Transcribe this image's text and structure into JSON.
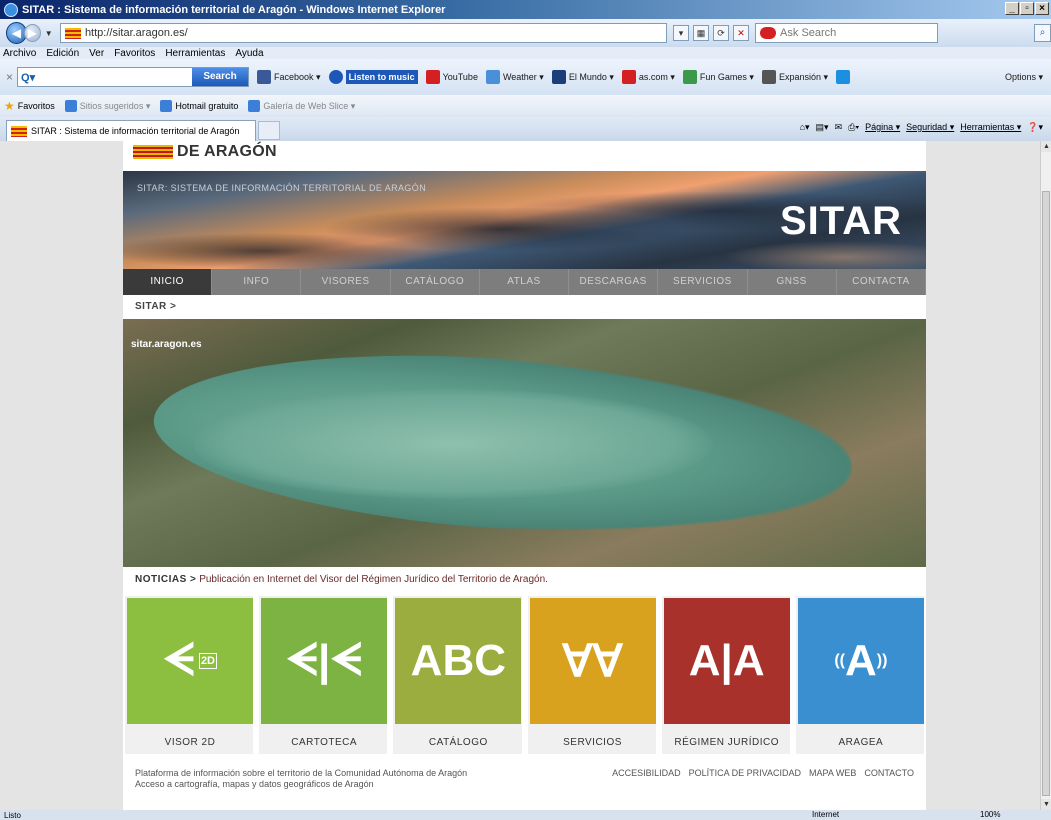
{
  "window": {
    "title": "SITAR : Sistema de información territorial de Aragón - Windows Internet Explorer"
  },
  "address": {
    "url": "http://sitar.aragon.es/",
    "search_placeholder": "Ask Search"
  },
  "menu": [
    "Archivo",
    "Edición",
    "Ver",
    "Favoritos",
    "Herramientas",
    "Ayuda"
  ],
  "toolbar": {
    "search_label": "Search",
    "items": [
      "Facebook ▾",
      "Listen to music",
      "YouTube",
      "Weather ▾",
      "El Mundo ▾",
      "as.com ▾",
      "Fun Games ▾",
      "Expansión ▾"
    ],
    "options": "Options ▾"
  },
  "favorites": {
    "label": "Favoritos",
    "items": [
      "Sitios sugeridos ▾",
      "Hotmail gratuito",
      "Galería de Web Slice ▾"
    ]
  },
  "tab": {
    "title": "SITAR : Sistema de información territorial de Aragón"
  },
  "commands": [
    "Página ▾",
    "Seguridad ▾",
    "Herramientas ▾"
  ],
  "site": {
    "logo_text": "DE ARAGÓN",
    "banner_subtitle": "SITAR: SISTEMA DE INFORMACIÓN TERRITORIAL DE ARAGÓN",
    "banner_title": "SITAR",
    "nav": [
      "INICIO",
      "INFO",
      "VISORES",
      "CATÁLOGO",
      "ATLAS",
      "DESCARGAS",
      "SERVICIOS",
      "GNSS",
      "CONTACTA"
    ],
    "breadcrumb": "SITAR  >",
    "hero_label": "sitar.aragon.es",
    "news_label": "NOTICIAS  >",
    "news_text": "Publicación en Internet del Visor del Régimen Jurídico del Territorio de Aragón.",
    "tiles": [
      {
        "label": "VISOR 2D",
        "glyph": "ᗕ",
        "color": "#8cbf3f"
      },
      {
        "label": "CARTOTECA",
        "glyph": "ᗕ|ᗕ",
        "color": "#7cb342"
      },
      {
        "label": "CATÁLOGO",
        "glyph": "ABC",
        "color": "#9aad3e"
      },
      {
        "label": "SERVICIOS",
        "glyph": "∀∀",
        "color": "#d9a21e"
      },
      {
        "label": "RÉGIMEN JURÍDICO",
        "glyph": "A|A",
        "color": "#a8312c"
      },
      {
        "label": "ARAGEA",
        "glyph": "A",
        "color": "#3a8fd0"
      }
    ],
    "footer_line1": "Plataforma de información sobre el territorio de la Comunidad Autónoma de Aragón",
    "footer_line2": "Acceso a cartografía, mapas y datos geográficos de Aragón",
    "footer_links": [
      "ACCESIBILIDAD",
      "POLÍTICA DE PRIVACIDAD",
      "MAPA WEB",
      "CONTACTO"
    ]
  },
  "status": {
    "left": "Listo",
    "zone": "Internet",
    "zoom": "100%"
  }
}
